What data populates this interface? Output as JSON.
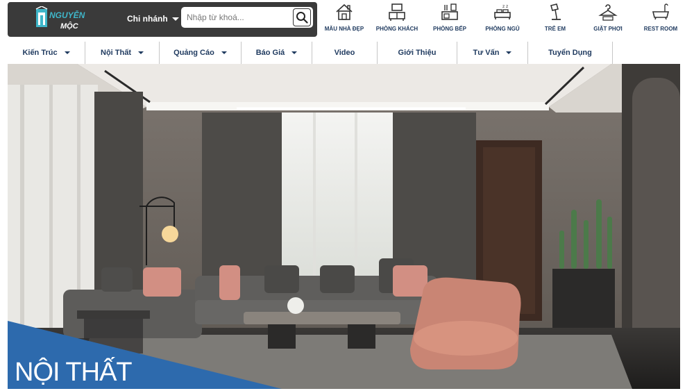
{
  "brand": {
    "logo_top": "NGUYỄN",
    "logo_bottom": "MỘC"
  },
  "header": {
    "branch_label": "Chi nhánh",
    "search_placeholder": "Nhập từ khoá..."
  },
  "categories": [
    {
      "label": "MẪU NHÀ ĐẸP",
      "icon": "house-icon"
    },
    {
      "label": "PHÒNG KHÁCH",
      "icon": "tv-cabinet-icon"
    },
    {
      "label": "PHÒNG BẾP",
      "icon": "kitchen-icon"
    },
    {
      "label": "PHÒNG NGỦ",
      "icon": "bed-icon"
    },
    {
      "label": "TRẺ EM",
      "icon": "desk-lamp-icon"
    },
    {
      "label": "GIẶT PHƠI",
      "icon": "hanger-icon"
    },
    {
      "label": "REST ROOM",
      "icon": "bathtub-icon"
    }
  ],
  "nav": [
    {
      "label": "Kiến Trúc",
      "dropdown": true
    },
    {
      "label": "Nội Thất",
      "dropdown": true
    },
    {
      "label": "Quảng Cáo",
      "dropdown": true
    },
    {
      "label": "Báo Giá",
      "dropdown": true
    },
    {
      "label": "Video",
      "dropdown": false
    },
    {
      "label": "Giới Thiệu",
      "dropdown": false
    },
    {
      "label": "Tư Vấn",
      "dropdown": true
    },
    {
      "label": "Tuyển Dụng",
      "dropdown": false
    }
  ],
  "hero": {
    "caption": "NỘI THẤT"
  },
  "colors": {
    "navy": "#1f3a5f",
    "topbar": "#3a3a3a",
    "banner_blue": "#2d6aad"
  }
}
